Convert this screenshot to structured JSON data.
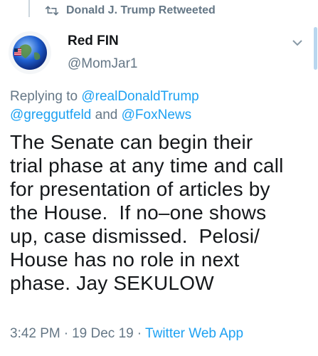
{
  "retweet_header": {
    "text": "Donald J. Trump Retweeted",
    "icon": "retweet-icon"
  },
  "author": {
    "name": "Red FIN",
    "handle": "@MomJar1",
    "avatar_icon": "globe-avatar"
  },
  "reply_context": {
    "prefix": "Replying to ",
    "mentions": [
      "@realDonaldTrump",
      "@greggutfeld",
      "@FoxNews"
    ],
    "joiner": " and "
  },
  "tweet": {
    "lines": [
      "The Senate can begin their",
      "trial phase at any time and call",
      "for presentation of articles by",
      "the House.  If no–one shows",
      "up, case dismissed.  Pelosi/",
      "House has no role in next",
      "phase. Jay SEKULOW"
    ]
  },
  "meta": {
    "time": "3:42 PM",
    "separator": "·",
    "date": "19 Dec 19",
    "source": "Twitter Web App"
  },
  "colors": {
    "accent": "#1da1f2",
    "secondary_text": "#657786",
    "primary_text": "#14171a"
  }
}
